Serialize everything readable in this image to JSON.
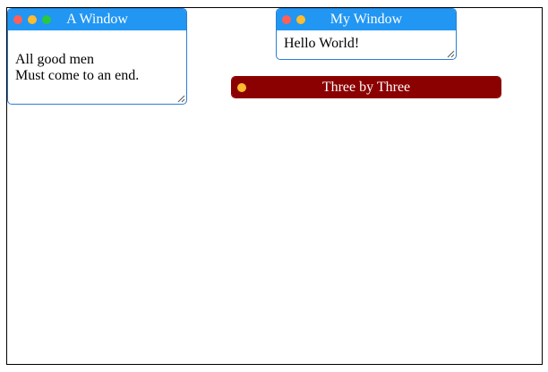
{
  "colors": {
    "titlebar_blue": "#2196f3",
    "titlebar_red": "#8b0000",
    "border_blue": "#2a7fd4",
    "dot_red": "#ff5f57",
    "dot_yellow": "#febc2e",
    "dot_green": "#28c840"
  },
  "windows": [
    {
      "title": "A Window",
      "lines": [
        "All good men",
        "Must come to an end."
      ],
      "controls": [
        "close-dot",
        "minimize-dot",
        "maximize-dot"
      ]
    },
    {
      "title": "My Window",
      "lines": [
        "Hello World!"
      ],
      "controls": [
        "close-dot",
        "minimize-dot"
      ]
    },
    {
      "title": "Three by Three",
      "lines": [],
      "controls": [
        "minimize-dot"
      ]
    }
  ]
}
